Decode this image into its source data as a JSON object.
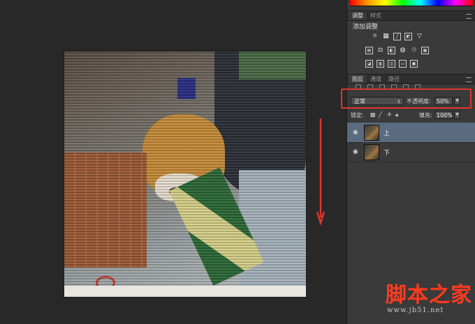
{
  "panel": {
    "adjustments_tabs": [
      "调整",
      "样式"
    ],
    "adjustments_title": "添加调整",
    "adjust_icons_row1": [
      "brightness-icon",
      "levels-icon",
      "curves-icon",
      "exposure-icon",
      "vibrance-icon"
    ],
    "adjust_icons_row2": [
      "hue-saturation-icon",
      "color-balance-icon",
      "black-white-icon",
      "photo-filter-icon",
      "channel-mixer-icon",
      "color-lookup-icon"
    ],
    "adjust_icons_row3": [
      "invert-icon",
      "posterize-icon",
      "threshold-icon",
      "gradient-map-icon",
      "selective-color-icon"
    ],
    "layers_tabs": [
      "图层",
      "通道",
      "路径"
    ],
    "blend_mode": "正常",
    "opacity_label": "不透明度:",
    "opacity_value": "50%",
    "lock_label": "锁定:",
    "fill_label": "填充:",
    "fill_value": "100%",
    "layers": [
      {
        "name": "上",
        "selected": true
      },
      {
        "name": "下",
        "selected": false
      }
    ]
  },
  "watermark": {
    "text": "脚本之家",
    "url": "www.jb51.net"
  },
  "colors": {
    "highlight_box": "#e0352b",
    "arrow": "#e0352b",
    "selected_layer": "#5a6b80"
  }
}
